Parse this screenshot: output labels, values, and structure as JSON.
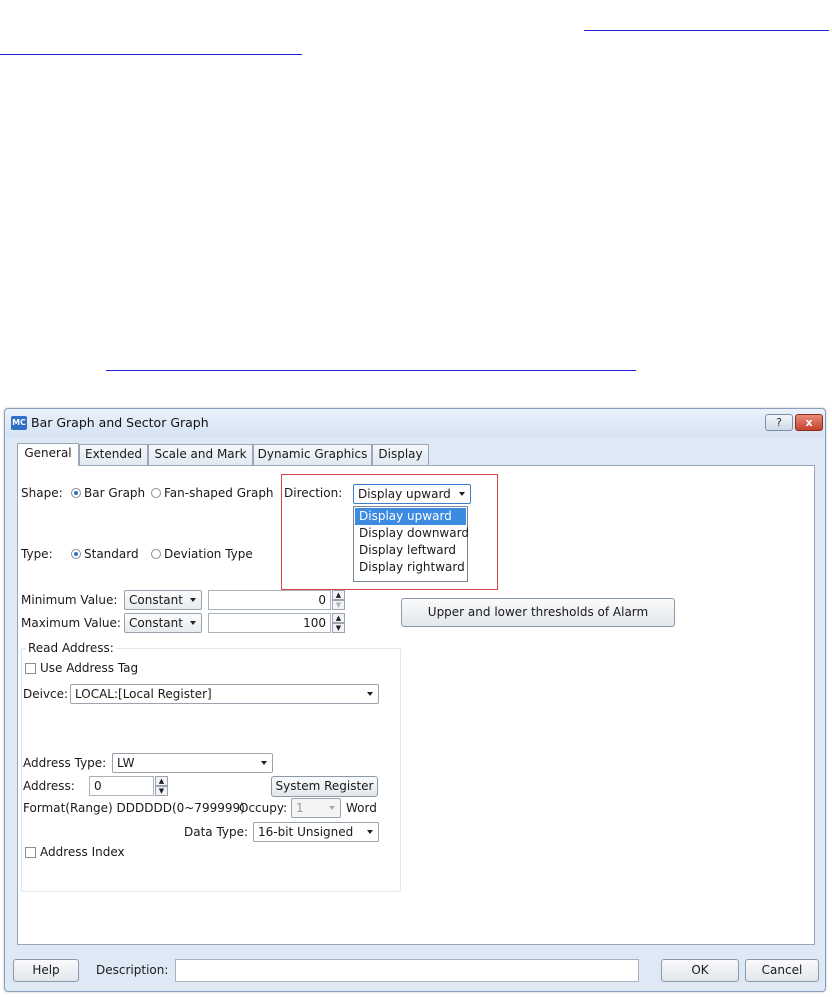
{
  "dialog": {
    "title": "Bar Graph and Sector Graph",
    "app_icon_text": "MC",
    "help_icon": "?",
    "close_icon": "x",
    "accent_color": "#3c8be0"
  },
  "tabs": [
    {
      "label": "General",
      "active": true
    },
    {
      "label": "Extended",
      "active": false
    },
    {
      "label": "Scale and Mark",
      "active": false
    },
    {
      "label": "Dynamic Graphics",
      "active": false
    },
    {
      "label": "Display",
      "active": false
    }
  ],
  "general": {
    "shape_label": "Shape:",
    "shape_options": [
      "Bar Graph",
      "Fan-shaped Graph"
    ],
    "shape_selected": "Bar Graph",
    "direction_label": "Direction:",
    "direction_value": "Display upward",
    "direction_options": [
      "Display upward",
      "Display downward",
      "Display leftward",
      "Display rightward"
    ],
    "type_label": "Type:",
    "type_options": [
      "Standard",
      "Deviation Type"
    ],
    "type_selected": "Standard",
    "min_label": "Minimum Value:",
    "min_mode": "Constant",
    "min_value": "0",
    "max_label": "Maximum Value:",
    "max_mode": "Constant",
    "max_value": "100",
    "alarm_button": "Upper and lower thresholds of Alarm",
    "read_address_label": "Read Address:",
    "use_address_tag": "Use Address Tag",
    "device_label": "Deivce:",
    "device_value": "LOCAL:[Local Register]",
    "address_type_label": "Address Type:",
    "address_type_value": "LW",
    "address_label": "Address:",
    "address_value": "0",
    "system_register_button": "System Register",
    "format_text": "Format(Range) DDDDDD(0~799999)",
    "occupy_label": "Occupy:",
    "occupy_value": "1",
    "occupy_unit": "Word",
    "data_type_label": "Data Type:",
    "data_type_value": "16-bit Unsigned",
    "address_index": "Address Index"
  },
  "footer": {
    "help_button": "Help",
    "description_label": "Description:",
    "description_value": "",
    "ok_button": "OK",
    "cancel_button": "Cancel"
  }
}
